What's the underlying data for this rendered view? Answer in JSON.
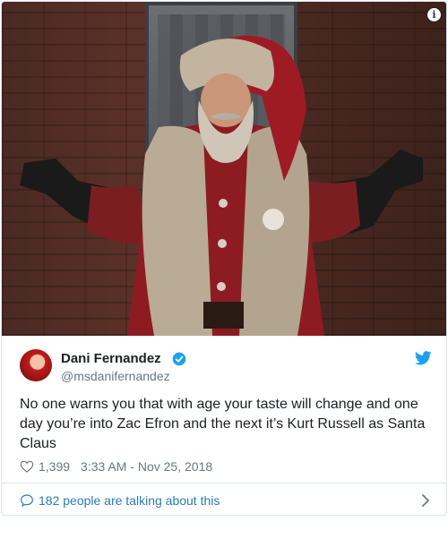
{
  "media": {
    "alt": "Santa Claus in red fur-trimmed coat with arms outstretched",
    "info_icon": "i"
  },
  "author": {
    "name": "Dani Fernandez",
    "handle": "@msdanifernandez",
    "verified": true
  },
  "tweet": {
    "text": "No one warns you that with age your taste will change and one day you’re into Zac Efron and the next it’s Kurt Russell as Santa Claus",
    "likes": "1,399",
    "timestamp": "3:33 AM - Nov 25, 2018"
  },
  "footer": {
    "talking_label": "182 people are talking about this"
  },
  "icons": {
    "verified": "verified-badge-icon",
    "brand": "twitter-bird-icon",
    "like": "heart-icon",
    "conversation": "speech-bubble-icon",
    "chevron": "chevron-right-icon"
  },
  "colors": {
    "brand_blue": "#1da1f2",
    "link_blue": "#2b7bb9",
    "muted": "#697882",
    "text": "#1c2022",
    "border": "#e1e8ed"
  }
}
